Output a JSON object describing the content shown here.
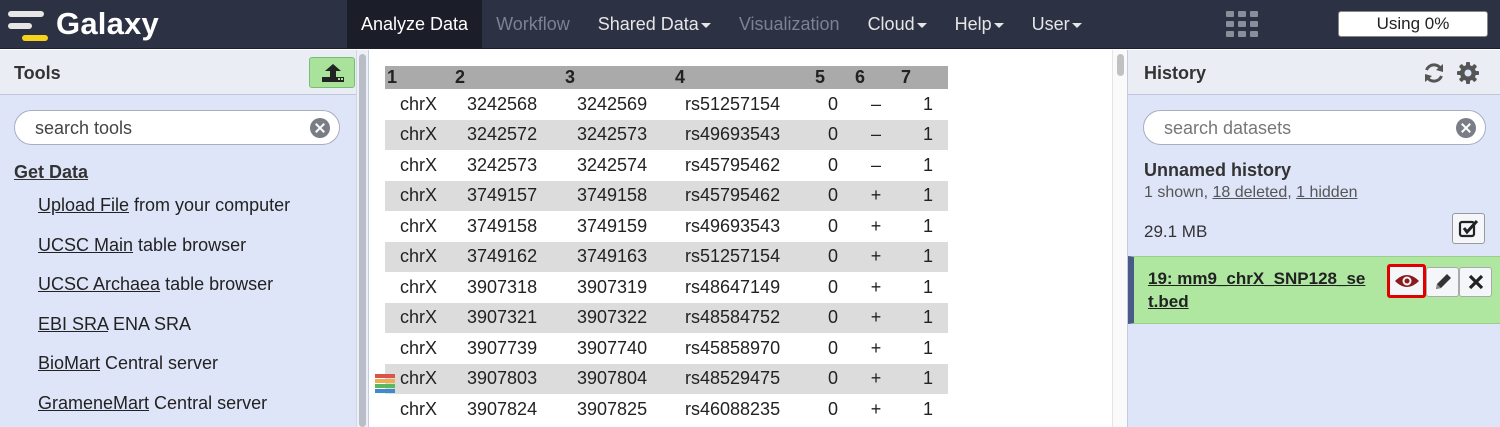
{
  "masthead": {
    "brand": "Galaxy",
    "nav": [
      {
        "label": "Analyze Data",
        "state": "active",
        "caret": false
      },
      {
        "label": "Workflow",
        "state": "disabled",
        "caret": false
      },
      {
        "label": "Shared Data",
        "state": "normal",
        "caret": true
      },
      {
        "label": "Visualization",
        "state": "disabled",
        "caret": false
      },
      {
        "label": "Cloud",
        "state": "normal",
        "caret": true
      },
      {
        "label": "Help",
        "state": "normal",
        "caret": true
      },
      {
        "label": "User",
        "state": "normal",
        "caret": true
      }
    ],
    "quota": "Using 0%"
  },
  "tools": {
    "title": "Tools",
    "search_placeholder": "search tools",
    "section": "Get Data",
    "items": [
      {
        "link": "Upload File",
        "desc": " from your computer"
      },
      {
        "link": "UCSC Main",
        "desc": " table browser"
      },
      {
        "link": "UCSC Archaea",
        "desc": " table browser"
      },
      {
        "link": "EBI SRA",
        "desc": " ENA SRA"
      },
      {
        "link": "BioMart",
        "desc": " Central server"
      },
      {
        "link": "GrameneMart",
        "desc": " Central server"
      }
    ]
  },
  "table": {
    "headers": [
      "1",
      "2",
      "3",
      "4",
      "5",
      "6",
      "7"
    ],
    "rows": [
      [
        "chrX",
        "3242568",
        "3242569",
        "rs51257154",
        "0",
        "–",
        "1"
      ],
      [
        "chrX",
        "3242572",
        "3242573",
        "rs49693543",
        "0",
        "–",
        "1"
      ],
      [
        "chrX",
        "3242573",
        "3242574",
        "rs45795462",
        "0",
        "–",
        "1"
      ],
      [
        "chrX",
        "3749157",
        "3749158",
        "rs45795462",
        "0",
        "+",
        "1"
      ],
      [
        "chrX",
        "3749158",
        "3749159",
        "rs49693543",
        "0",
        "+",
        "1"
      ],
      [
        "chrX",
        "3749162",
        "3749163",
        "rs51257154",
        "0",
        "+",
        "1"
      ],
      [
        "chrX",
        "3907318",
        "3907319",
        "rs48647149",
        "0",
        "+",
        "1"
      ],
      [
        "chrX",
        "3907321",
        "3907322",
        "rs48584752",
        "0",
        "+",
        "1"
      ],
      [
        "chrX",
        "3907739",
        "3907740",
        "rs45858970",
        "0",
        "+",
        "1"
      ],
      [
        "chrX",
        "3907803",
        "3907804",
        "rs48529475",
        "0",
        "+",
        "1"
      ],
      [
        "chrX",
        "3907824",
        "3907825",
        "rs46088235",
        "0",
        "+",
        "1"
      ]
    ]
  },
  "history": {
    "title": "History",
    "search_placeholder": "search datasets",
    "name": "Unnamed history",
    "shown": "1 shown, ",
    "deleted": "18 deleted",
    "sep": ", ",
    "hidden": "1 hidden",
    "size": "29.1 MB",
    "dataset_title": "19: mm9_chrX_SNP128_set.bed"
  },
  "colors": {
    "masthead": "#2c3143",
    "panel": "#dfe5f9",
    "dataset_ok": "#afe7a1",
    "highlight": "#e00000"
  },
  "icons": [
    "upload-icon",
    "clear-search-icon",
    "refresh-icon",
    "gear-icon",
    "checkbox-icon",
    "eye-icon",
    "pencil-icon",
    "close-icon",
    "apps-grid-icon",
    "stack-icon"
  ]
}
